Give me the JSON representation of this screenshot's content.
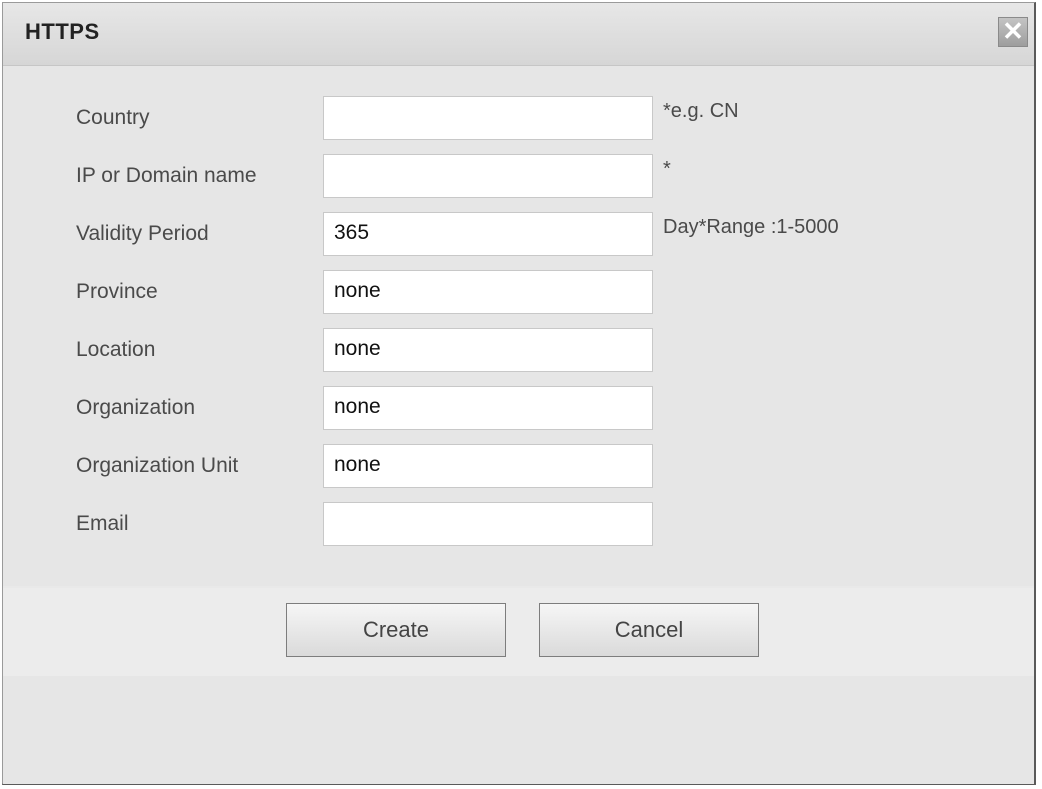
{
  "dialog": {
    "title": "HTTPS",
    "close_icon": "close-icon",
    "close_glyph": "✕"
  },
  "form": {
    "fields": [
      {
        "label": "Country",
        "value": "",
        "hint": "*e.g. CN"
      },
      {
        "label": "IP or Domain name",
        "value": "",
        "hint": "*"
      },
      {
        "label": "Validity Period",
        "value": "365",
        "hint": "Day*Range :1-5000"
      },
      {
        "label": "Province",
        "value": "none",
        "hint": ""
      },
      {
        "label": "Location",
        "value": "none",
        "hint": ""
      },
      {
        "label": "Organization",
        "value": "none",
        "hint": ""
      },
      {
        "label": "Organization Unit",
        "value": "none",
        "hint": ""
      },
      {
        "label": "Email",
        "value": "",
        "hint": ""
      }
    ]
  },
  "buttons": {
    "create_label": "Create",
    "cancel_label": "Cancel"
  }
}
